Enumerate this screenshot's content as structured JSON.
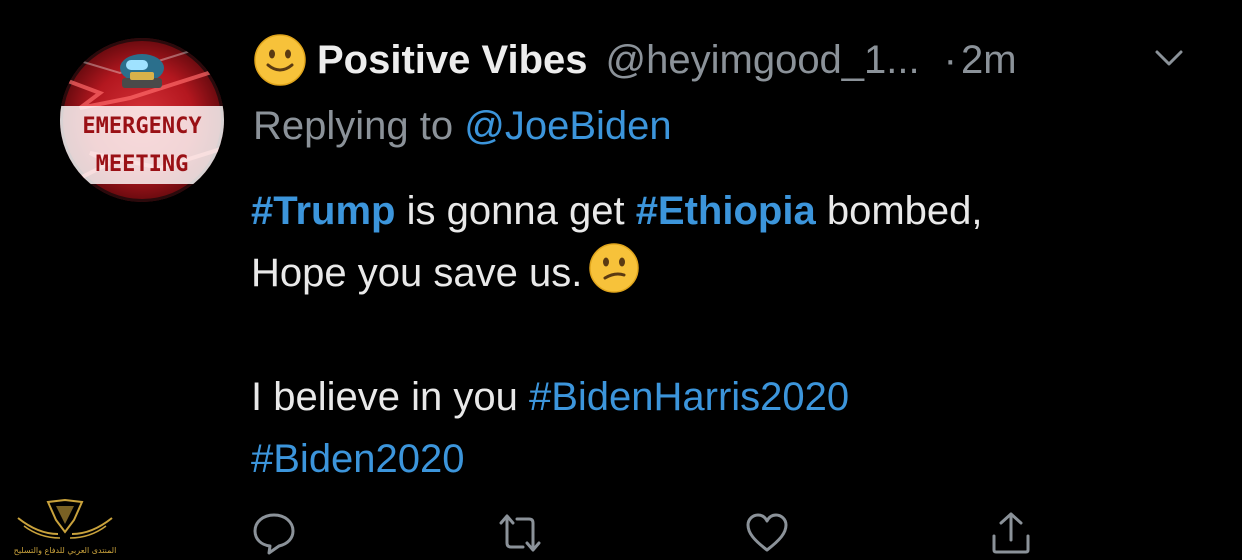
{
  "tweet": {
    "avatar": {
      "line1": "EMERGENCY",
      "line2": "MEETING"
    },
    "display_name": "Positive Vibes",
    "handle": "@heyimgood_1...",
    "separator": "·",
    "time": "2m",
    "reply_prefix": "Replying to",
    "reply_handle": "@JoeBiden",
    "body": {
      "hashtag_trump": "#Trump",
      "text_1": "is gonna get",
      "hashtag_ethiopia": "#Ethiopia",
      "text_2": "bombed,",
      "text_3": "Hope you save us.",
      "text_4": "I believe in you",
      "hashtag_bidenharris": "#BidenHarris2020",
      "hashtag_biden": "#Biden2020"
    },
    "icons": {
      "name_emoji": "slightly-smiling-face",
      "body_emoji": "confused-face",
      "menu": "chevron-down-icon",
      "reply": "comment-icon",
      "retweet": "retweet-icon",
      "like": "heart-icon",
      "share": "share-icon"
    }
  },
  "watermark": {
    "text": "المنتدى العربي للدفاع والتسليح"
  },
  "colors": {
    "background": "#000000",
    "text": "#e9e9e9",
    "muted": "#8b9299",
    "link": "#3c95db",
    "emoji": "#f7c23a"
  }
}
